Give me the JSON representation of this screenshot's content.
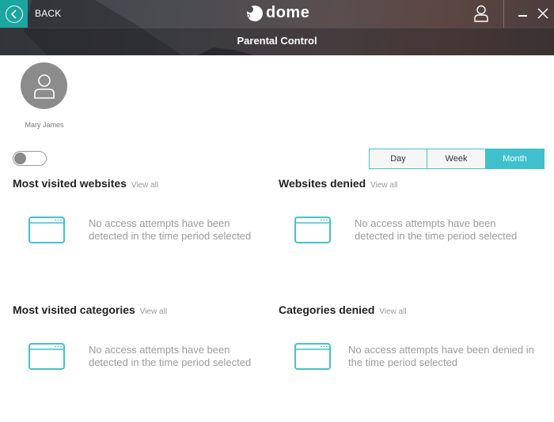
{
  "header": {
    "back_label": "BACK",
    "brand": "dome",
    "page_title": "Parental Control"
  },
  "profile": {
    "name": "Mary James",
    "monitoring_enabled": false
  },
  "period_selector": {
    "options": [
      "Day",
      "Week",
      "Month"
    ],
    "selected": "Month"
  },
  "colors": {
    "accent": "#3fc0cc",
    "back_button": "#1aa5a0",
    "avatar": "#8c8c8c"
  },
  "sections": [
    {
      "title": "Most visited websites",
      "view_all": "View all",
      "empty_message": "No access attempts have been detected in the time period selected"
    },
    {
      "title": "Websites denied",
      "view_all": "View all",
      "empty_message": "No access attempts have been detected in the time period selected"
    },
    {
      "title": "Most visited categories",
      "view_all": "View all",
      "empty_message": "No access attempts have been detected in the time period selected"
    },
    {
      "title": "Categories denied",
      "view_all": "View all",
      "empty_message": "No access attempts have been denied in the time period selected"
    }
  ]
}
